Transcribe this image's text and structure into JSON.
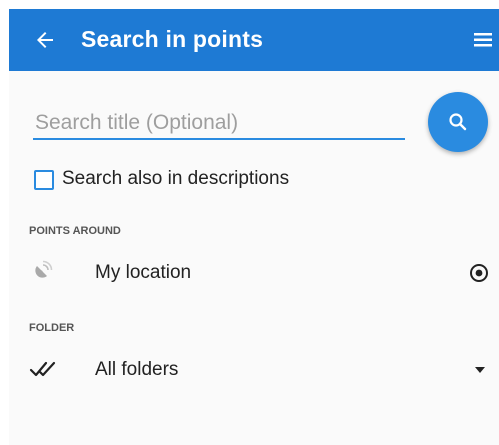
{
  "header": {
    "title": "Search in points",
    "back_icon": "arrow-back-icon",
    "menu_icon": "hamburger-menu-icon",
    "color": "#1e7ad4"
  },
  "search": {
    "placeholder": "Search title (Optional)",
    "value": "",
    "button_icon": "search-icon",
    "accent": "#2a8be0"
  },
  "options": {
    "search_descriptions_label": "Search also in descriptions",
    "search_descriptions_checked": false
  },
  "points_around": {
    "header": "POINTS AROUND",
    "label": "My location",
    "icon": "gps-signal-icon",
    "action_icon": "target-location-icon"
  },
  "folder": {
    "header": "FOLDER",
    "label": "All folders",
    "icon": "double-check-icon",
    "dropdown_icon": "dropdown-arrow-icon"
  }
}
